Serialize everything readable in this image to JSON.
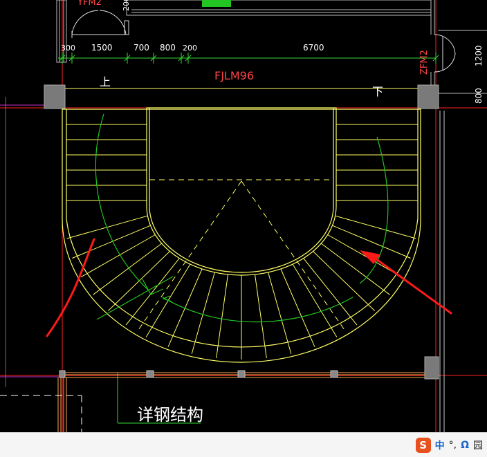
{
  "drawing": {
    "door_label_top": "YFM2",
    "door_label_right": "ZFM2",
    "dim_wall_top": "200",
    "dims_top": [
      "300",
      "1500",
      "700",
      "800",
      "200",
      "6700"
    ],
    "dims_right": [
      "1200",
      "800"
    ],
    "curtain_label": "FJLM96",
    "up_label": "上",
    "down_label": "下",
    "note_label": "详钢结构"
  },
  "colors": {
    "background": "#000000",
    "stair": "#ffff66",
    "walk_line": "#22c522",
    "axis_red": "#ff2020",
    "axis_magenta": "#cc33cc",
    "dimension": "#33dd33",
    "column": "#7a7a7a",
    "annotation_red": "#ff1a1a"
  },
  "status_bar": {
    "ime_logo": "S",
    "ime_lang": "中",
    "ime_punct": "°,",
    "ime_omega": "Ω",
    "ime_tail": "园"
  }
}
